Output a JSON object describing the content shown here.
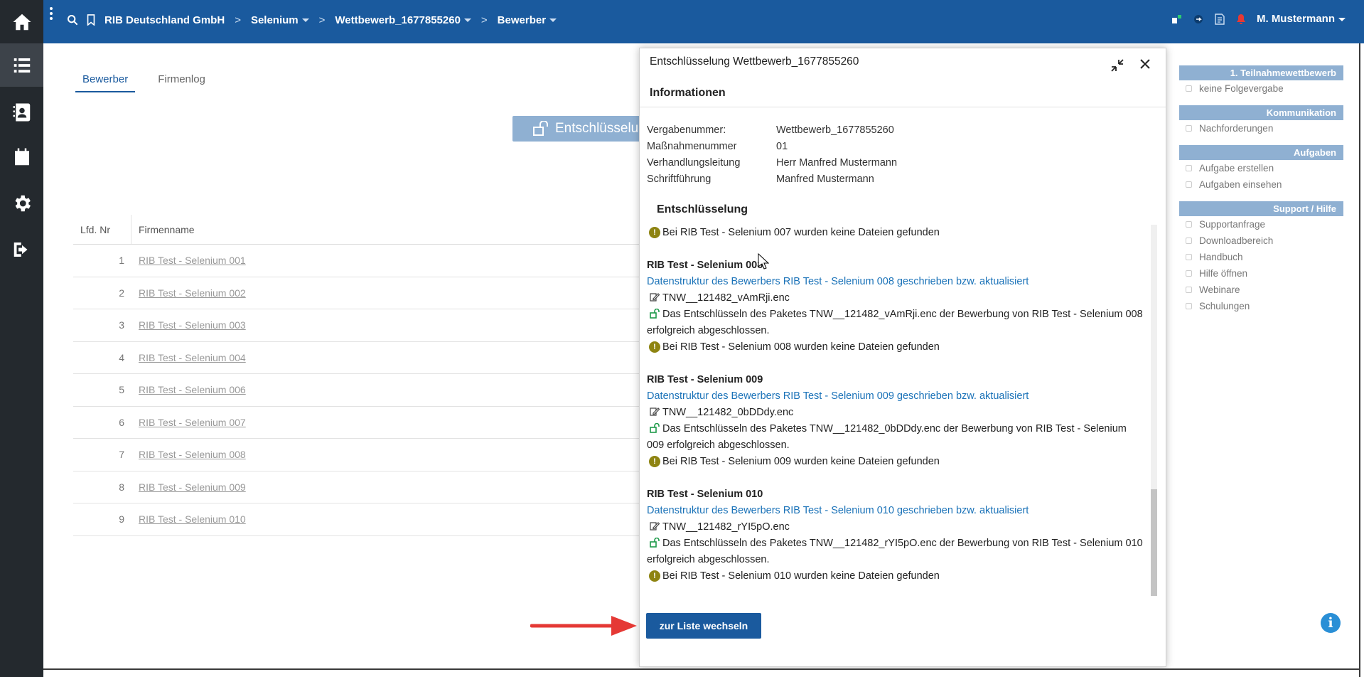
{
  "header": {
    "breadcrumbs": [
      {
        "label": "RIB Deutschland GmbH",
        "has_caret": false
      },
      {
        "label": "Selenium",
        "has_caret": true
      },
      {
        "label": "Wettbewerb_1677855260",
        "has_caret": true
      },
      {
        "label": "Bewerber",
        "has_caret": true
      }
    ],
    "user": "M. Mustermann",
    "breadcrumb_separator": ">"
  },
  "rail": {
    "items": [
      "home-icon",
      "list-icon",
      "contacts-icon",
      "calendar-icon",
      "gear-icon",
      "logout-icon"
    ]
  },
  "tabs": [
    {
      "label": "Bewerber",
      "active": true
    },
    {
      "label": "Firmenlog",
      "active": false
    }
  ],
  "action_button": {
    "label": "Entschlüsselung"
  },
  "table": {
    "columns": [
      "Lfd. Nr",
      "Firmenname"
    ],
    "rows": [
      {
        "nr": "1",
        "name": "RIB Test - Selenium 001"
      },
      {
        "nr": "2",
        "name": "RIB Test - Selenium 002"
      },
      {
        "nr": "3",
        "name": "RIB Test - Selenium 003"
      },
      {
        "nr": "4",
        "name": "RIB Test - Selenium 004"
      },
      {
        "nr": "5",
        "name": "RIB Test - Selenium 006"
      },
      {
        "nr": "6",
        "name": "RIB Test - Selenium 007"
      },
      {
        "nr": "7",
        "name": "RIB Test - Selenium 008"
      },
      {
        "nr": "8",
        "name": "RIB Test - Selenium 009"
      },
      {
        "nr": "9",
        "name": "RIB Test - Selenium 010"
      }
    ]
  },
  "right_panel": {
    "sections": [
      {
        "title": "1. Teilnahmewettbewerb",
        "items": [
          "keine Folgevergabe"
        ]
      },
      {
        "title": "Kommunikation",
        "items": [
          "Nachforderungen"
        ]
      },
      {
        "title": "Aufgaben",
        "items": [
          "Aufgabe erstellen",
          "Aufgaben einsehen"
        ]
      },
      {
        "title": "Support / Hilfe",
        "items": [
          "Supportanfrage",
          "Downloadbereich",
          "Handbuch",
          "Hilfe öffnen",
          "Webinare",
          "Schulungen"
        ]
      }
    ]
  },
  "info_button": {
    "label": "i"
  },
  "modal": {
    "title": "Entschlüsselung Wettbewerb_1677855260",
    "info_heading": "Informationen",
    "info": [
      {
        "key": "Vergabenummer:",
        "value": "Wettbewerb_1677855260"
      },
      {
        "key": "Maßnahmenummer",
        "value": "01"
      },
      {
        "key": "Verhandlungsleitung",
        "value": "Herr Manfred Mustermann"
      },
      {
        "key": "Schriftführung",
        "value": "Manfred Mustermann"
      }
    ],
    "decrypt_heading": "Entschlüsselung",
    "log": [
      {
        "type": "warn",
        "text": "Bei RIB Test - Selenium 007 wurden keine Dateien gefunden"
      },
      {
        "type": "spacer"
      },
      {
        "type": "group",
        "text": "RIB Test - Selenium 008"
      },
      {
        "type": "link",
        "text": "Datenstruktur des Bewerbers RIB Test - Selenium 008 geschrieben bzw. aktualisiert"
      },
      {
        "type": "file",
        "text": "TNW__121482_vAmRji.enc"
      },
      {
        "type": "unlock",
        "text": "Das Entschlüsseln des Paketes TNW__121482_vAmRji.enc der Bewerbung von RIB Test - Selenium 008",
        "cont": "erfolgreich abgeschlossen."
      },
      {
        "type": "warn",
        "text": "Bei RIB Test - Selenium 008 wurden keine Dateien gefunden"
      },
      {
        "type": "spacer"
      },
      {
        "type": "group",
        "text": "RIB Test - Selenium 009"
      },
      {
        "type": "link",
        "text": "Datenstruktur des Bewerbers RIB Test - Selenium 009 geschrieben bzw. aktualisiert"
      },
      {
        "type": "file",
        "text": "TNW__121482_0bDDdy.enc"
      },
      {
        "type": "unlock",
        "text": "Das Entschlüsseln des Paketes TNW__121482_0bDDdy.enc der Bewerbung von RIB Test - Selenium",
        "cont": "009 erfolgreich abgeschlossen."
      },
      {
        "type": "warn",
        "text": "Bei RIB Test - Selenium 009 wurden keine Dateien gefunden"
      },
      {
        "type": "spacer"
      },
      {
        "type": "group",
        "text": "RIB Test - Selenium 010"
      },
      {
        "type": "link",
        "text": "Datenstruktur des Bewerbers RIB Test - Selenium 010 geschrieben bzw. aktualisiert"
      },
      {
        "type": "file",
        "text": "TNW__121482_rYI5pO.enc"
      },
      {
        "type": "unlock",
        "text": "Das Entschlüsseln des Paketes TNW__121482_rYI5pO.enc der Bewerbung von RIB Test - Selenium 010",
        "cont": "erfolgreich abgeschlossen."
      },
      {
        "type": "warn",
        "text": "Bei RIB Test - Selenium 010 wurden keine Dateien gefunden"
      }
    ],
    "button": "zur Liste wechseln"
  },
  "colors": {
    "header_bg": "#1a5a9e",
    "rail_bg": "#24292e",
    "panel_head": "#8fb0d2",
    "link": "#1a72b8",
    "warn": "#8e8412",
    "unlock": "#1e9a4a",
    "arrow": "#e53935"
  }
}
